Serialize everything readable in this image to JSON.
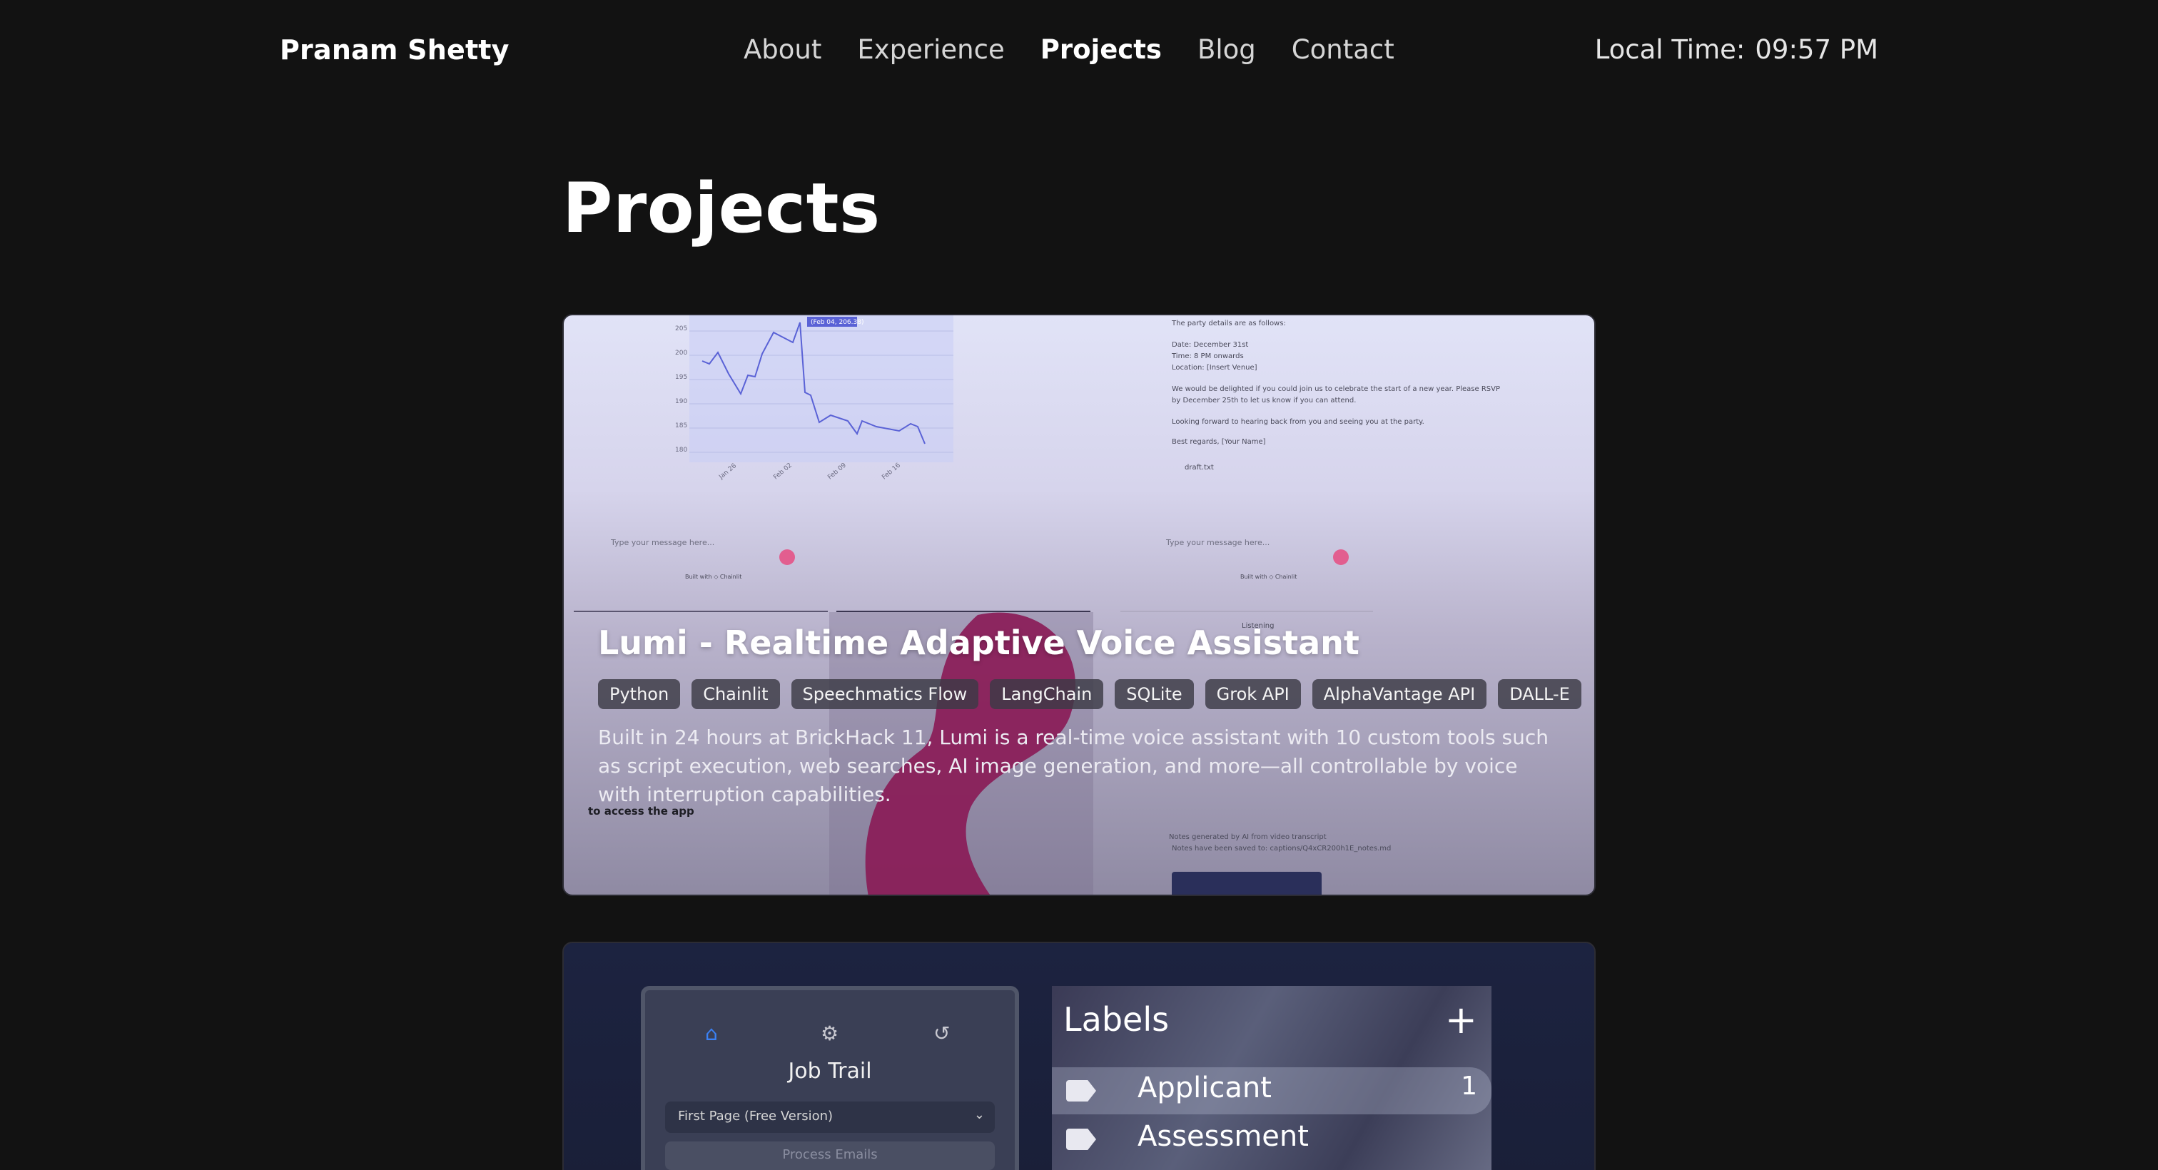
{
  "header": {
    "brand": "Pranam Shetty",
    "nav": [
      "About",
      "Experience",
      "Projects",
      "Blog",
      "Contact"
    ],
    "active_nav": "Projects",
    "clock_label": "Local Time:",
    "clock_value": "09:57 PM"
  },
  "page": {
    "title": "Projects"
  },
  "projects": [
    {
      "title": "Lumi - Realtime Adaptive Voice Assistant",
      "tags": [
        "Python",
        "Chainlit",
        "Speechmatics Flow",
        "LangChain",
        "SQLite",
        "Grok API",
        "AlphaVantage API",
        "DALL-E"
      ],
      "description": "Built in 24 hours at BrickHack 11, Lumi is a real-time voice assistant with 10 custom tools such as script execution, web searches, AI image generation, and more—all controllable by voice with interruption capabilities.",
      "preview": {
        "chart_ticks_y": [
          "205",
          "200",
          "195",
          "190",
          "185",
          "180"
        ],
        "chart_ticks_x": [
          "Jan 26",
          "Feb 02",
          "Feb 09",
          "Feb 16"
        ],
        "chart_tooltip": "(Feb 04, 206.38)",
        "email_lines": [
          "The party details are as follows:",
          "Date: December 31st",
          "Time: 8 PM onwards",
          "Location: [Insert Venue]",
          "We would be delighted if you could join us to celebrate the start of a new year. Please RSVP",
          "by December 25th to let us know if you can attend.",
          "Looking forward to hearing back from you and seeing you at the party.",
          "Best regards, [Your Name]"
        ],
        "attachment": "draft.txt",
        "input_placeholder": "Type your message here...",
        "built_with": "Built with ◇ Chainlit",
        "listening": "Listening",
        "note_saved": "Notes have been saved to: captions/Q4xCR200h1E_notes.md",
        "notes_caption": "Notes generated by AI from video transcript",
        "access_label": "to access the app"
      }
    },
    {
      "preview": {
        "app_title": "Job Trail",
        "select_value": "First Page (Free Version)",
        "process_button": "Process Emails",
        "labels_title": "Labels",
        "labels": [
          {
            "name": "Applicant",
            "count": "1"
          },
          {
            "name": "Assessment",
            "count": ""
          }
        ]
      }
    }
  ],
  "colors": {
    "background": "#121212",
    "accent_pink": "#e25e8f",
    "blob_magenta": "#8a1a55"
  }
}
